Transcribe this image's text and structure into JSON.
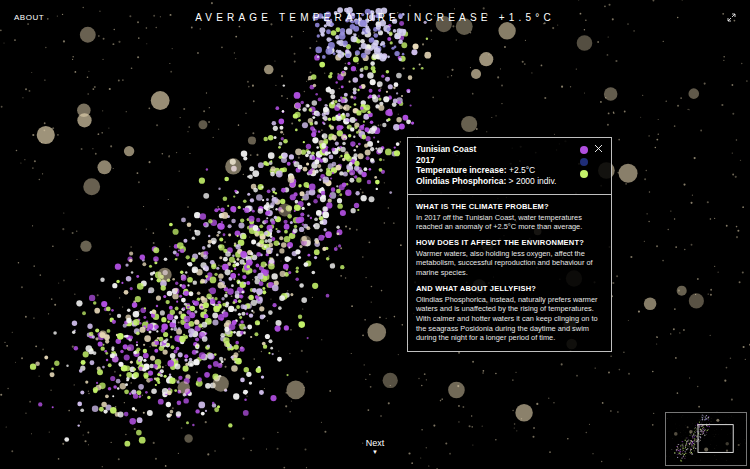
{
  "header": {
    "about": "ABOUT",
    "title": "AVERAGE TEMPERATURE INCREASE +1.5°C"
  },
  "popup": {
    "place": "Tunisian Coast",
    "year": "2017",
    "facts": [
      {
        "label": "Temperature increase:",
        "value": "+2.5°C"
      },
      {
        "label": "Olindias Phosphorica:",
        "value": "> 2000 indiv."
      }
    ],
    "legend": [
      {
        "color": "#b04fe0"
      },
      {
        "color": "#1f2d78"
      },
      {
        "color": "#c4f26a"
      }
    ],
    "sections": [
      {
        "heading": "WHAT IS THE CLIMATE PROBLEM?",
        "text": "In 2017 off the Tunisian Coast, water temperatures reached an anomaly of +2.5°C more than average."
      },
      {
        "heading": "HOW DOES IT AFFECT THE ENVIRONMENT?",
        "text": "Warmer waters, also holding less oxygen, affect the metabolism, successful reproduction and behaviour of marine species."
      },
      {
        "heading": "AND WHAT ABOUT JELLYFISH?",
        "text": "Olindias Phosphorica, instead, naturally prefers warmer waters and is unaffected by the rising of temperatures. With calmer and hotter waters it can keep clinging on to the seagrass Posidonia during the daytime and swim during the night for a longer period of time."
      }
    ]
  },
  "navigation": {
    "next": "Next",
    "arrow": "▼"
  }
}
